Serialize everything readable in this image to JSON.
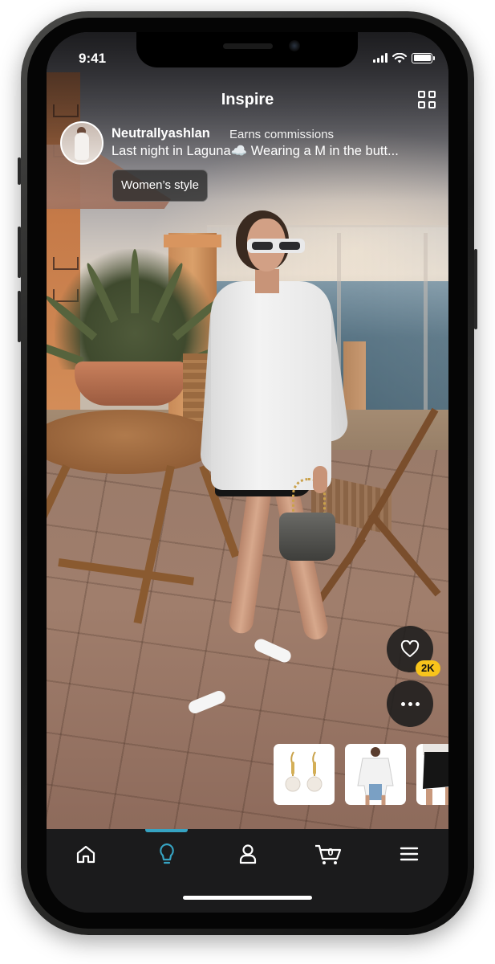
{
  "status_bar": {
    "time": "9:41"
  },
  "header": {
    "title": "Inspire",
    "grid_icon": "grid-view-icon"
  },
  "post": {
    "creator_name": "Neutrallyashlan",
    "creator_badge": "Earns commissions",
    "caption": "Last night in Laguna☁️ Wearing a M in the butt...",
    "tag": "Women’s style"
  },
  "actions": {
    "like_icon": "heart-icon",
    "like_count": "2K",
    "more_icon": "more-options-icon"
  },
  "products": [
    {
      "name": "pearl-drop-earrings"
    },
    {
      "name": "white-button-shirt"
    },
    {
      "name": "black-mini-skort"
    }
  ],
  "tabbar": {
    "active_color": "#36a3c2",
    "active_tab": "inspire",
    "items": [
      {
        "icon": "home-icon"
      },
      {
        "icon": "lightbulb-icon"
      },
      {
        "icon": "account-icon"
      },
      {
        "icon": "cart-icon",
        "cart_count": "0"
      },
      {
        "icon": "menu-icon"
      }
    ]
  },
  "colors": {
    "badge_yellow": "#f8c41b",
    "tabbar_bg": "#1b1b1c"
  }
}
